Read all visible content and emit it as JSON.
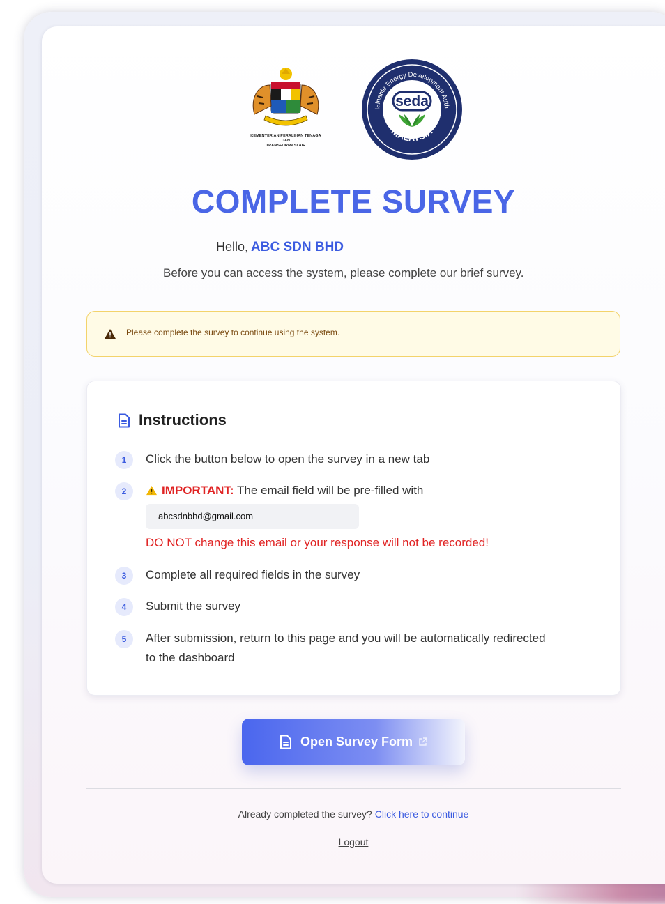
{
  "logos": {
    "kementerian_caption_line1": "KEMENTERIAN PERALIHAN TENAGA DAN",
    "kementerian_caption_line2": "TRANSFORMASI AIR",
    "seda_wordmark": "seda",
    "seda_ring_text": "Sustainable Energy Development Authority",
    "seda_country": "MALAYSIA"
  },
  "page_title": "COMPLETE SURVEY",
  "greeting": {
    "prefix": "Hello,",
    "company_name": "ABC SDN BHD"
  },
  "subtitle": "Before you can access the system, please complete our brief survey.",
  "alert": {
    "icon": "warning-triangle-icon",
    "text": "Please complete the survey to continue using the system."
  },
  "instructions": {
    "heading": "Instructions",
    "icon": "document-icon",
    "steps": [
      {
        "num": "1",
        "text": "Click the button below to open the survey in a new tab"
      },
      {
        "num": "2",
        "important_label": "IMPORTANT:",
        "text": "The email field will be pre-filled with",
        "email": "abcsdnbhd@gmail.com",
        "warning": "DO NOT change this email or your response will not be recorded!"
      },
      {
        "num": "3",
        "text": "Complete all required fields in the survey"
      },
      {
        "num": "4",
        "text": "Submit the survey"
      },
      {
        "num": "5",
        "text_line1": "After submission, return to this page and you will be automatically redirected",
        "text_line2": "to the dashboard"
      }
    ]
  },
  "open_button": {
    "label": "Open Survey Form",
    "icon": "document-icon",
    "trailing_icon": "external-link-icon"
  },
  "footer": {
    "already_text": "Already completed the survey?",
    "continue_link": "Click here to continue",
    "logout": "Logout"
  },
  "colors": {
    "accent": "#4a66e6",
    "link": "#3b5be0",
    "danger": "#e02424",
    "alert_bg": "#fffbe6",
    "alert_border": "#f3d36b"
  }
}
